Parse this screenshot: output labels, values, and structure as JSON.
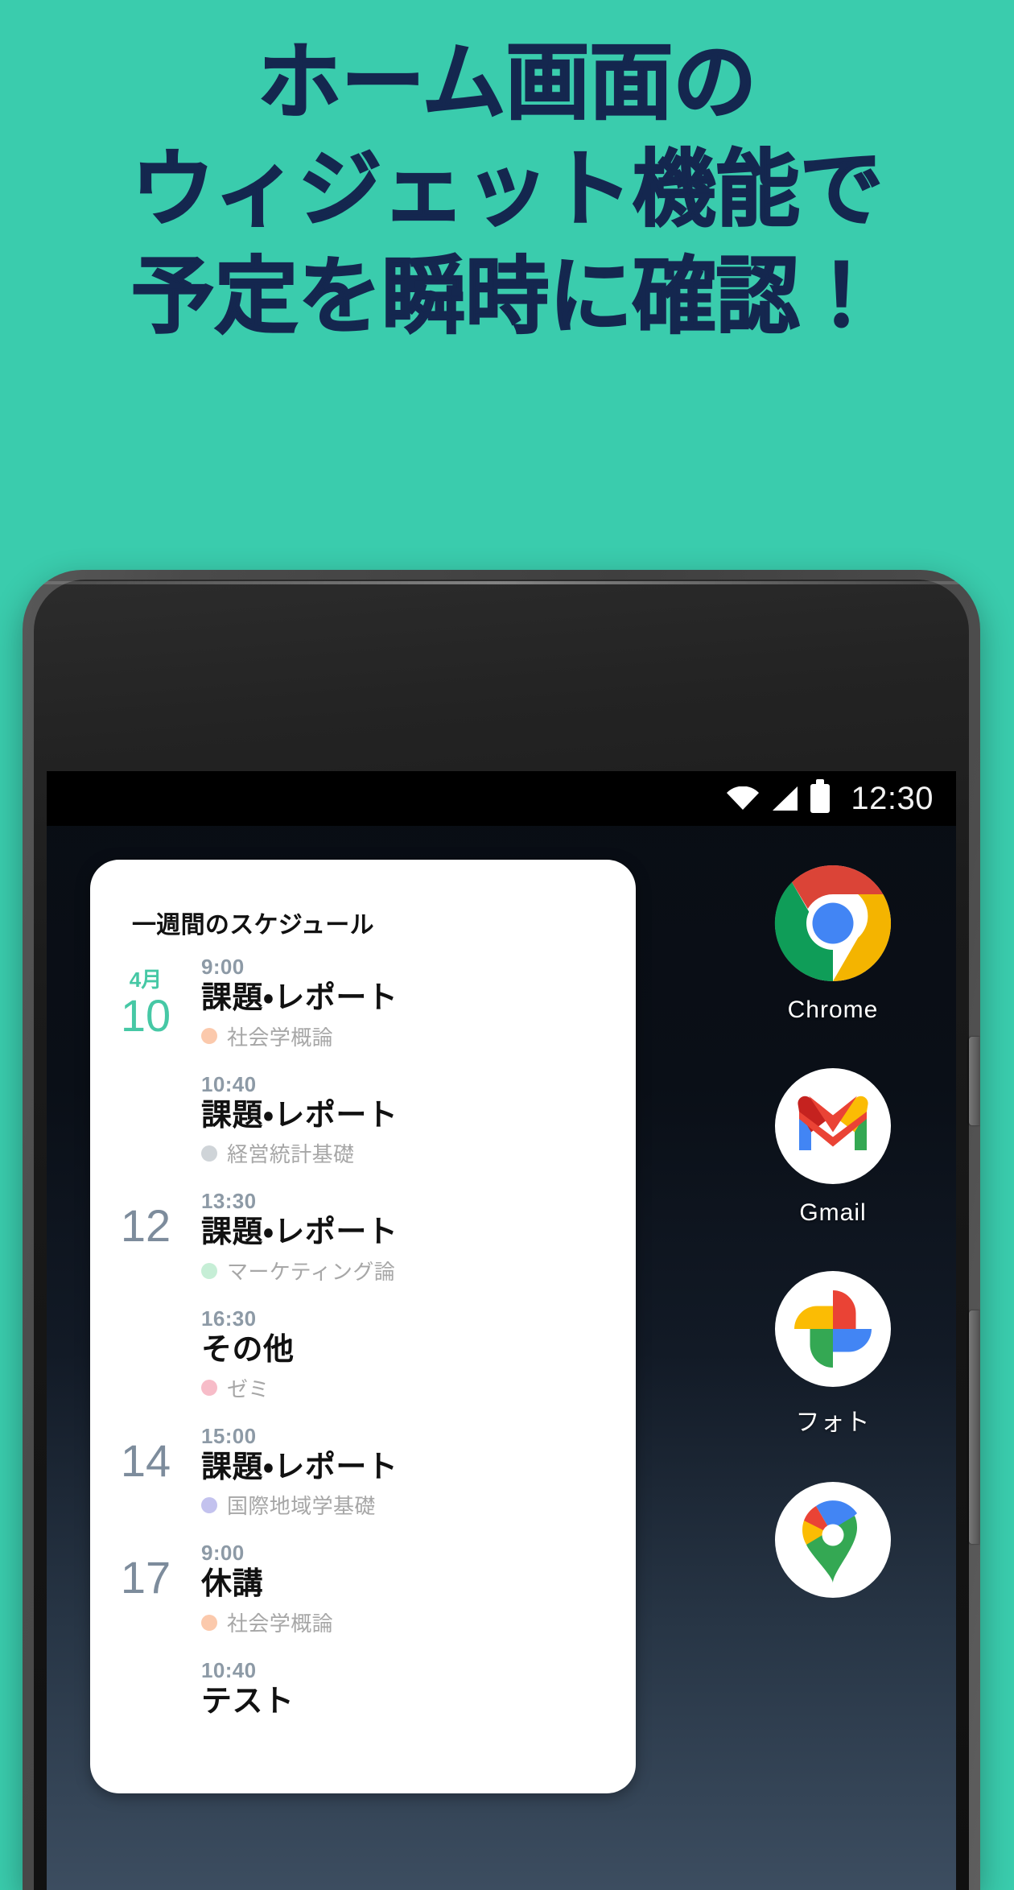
{
  "promo": {
    "background_color": "#3ACCAD",
    "text_color": "#14274F",
    "line1": "ホーム画面の",
    "line2": "ウィジェット機能で",
    "line3": "予定を瞬時に確認！"
  },
  "phone": {
    "statusbar": {
      "clock": "12:30",
      "icons": [
        "wifi-icon",
        "cellular-signal-icon",
        "battery-icon"
      ]
    },
    "widget": {
      "title": "一週間のスケジュール",
      "events": [
        {
          "month": "4月",
          "day": "10",
          "day_accent": true,
          "time": "9:00",
          "title": "課題・レポート",
          "subject": "社会学概論",
          "dot_color": "#FBC9AC"
        },
        {
          "month": "",
          "day": "",
          "day_accent": false,
          "time": "10:40",
          "title": "課題・レポート",
          "subject": "経営統計基礎",
          "dot_color": "#CFD4D8"
        },
        {
          "month": "",
          "day": "12",
          "day_accent": false,
          "time": "13:30",
          "title": "課題・レポート",
          "subject": "マーケティング論",
          "dot_color": "#C6EED6"
        },
        {
          "month": "",
          "day": "",
          "day_accent": false,
          "time": "16:30",
          "title": "その他",
          "subject": "ゼミ",
          "dot_color": "#F7BCC8"
        },
        {
          "month": "",
          "day": "14",
          "day_accent": false,
          "time": "15:00",
          "title": "課題・レポート",
          "subject": "国際地域学基礎",
          "dot_color": "#C3C2EE"
        },
        {
          "month": "",
          "day": "17",
          "day_accent": false,
          "time": "9:00",
          "title": "休講",
          "subject": "社会学概論",
          "dot_color": "#FBC9AC"
        },
        {
          "month": "",
          "day": "",
          "day_accent": false,
          "time": "10:40",
          "title": "テスト",
          "subject": "",
          "dot_color": ""
        }
      ]
    },
    "apps": [
      {
        "name": "chrome",
        "label": "Chrome"
      },
      {
        "name": "gmail",
        "label": "Gmail"
      },
      {
        "name": "photos",
        "label": "フォト"
      },
      {
        "name": "maps",
        "label": ""
      }
    ]
  }
}
